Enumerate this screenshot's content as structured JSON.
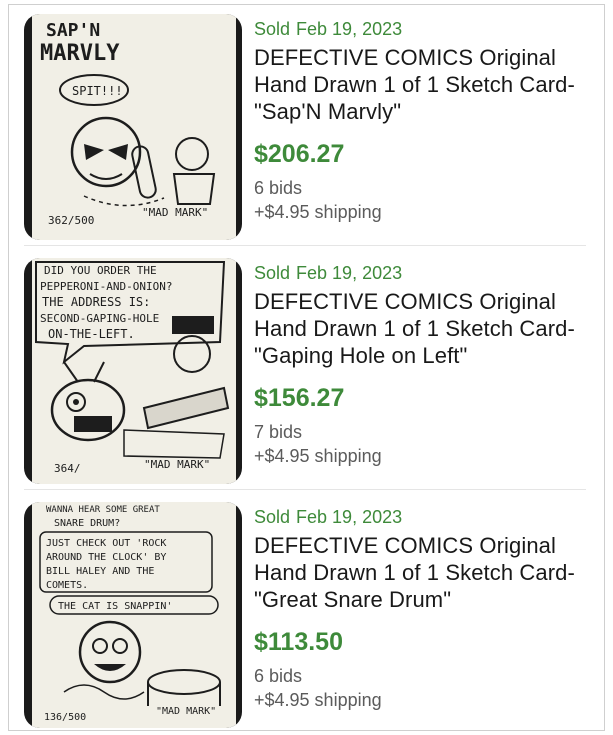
{
  "listings": [
    {
      "status": "Sold",
      "date": "Feb 19, 2023",
      "title_lines": [
        "DEFECTIVE COMICS Original",
        "Hand Drawn 1 of 1 Sketch Card-",
        "\"Sap'N Marvly\""
      ],
      "price": "$206.27",
      "bids": "6 bids",
      "shipping": "+$4.95 shipping",
      "thumb": {
        "headline": [
          "SAP'N",
          "MARVLY"
        ],
        "balloon": "SPIT!!!",
        "number": "362/500",
        "signature": "\"MAD MARK\""
      }
    },
    {
      "status": "Sold",
      "date": "Feb 19, 2023",
      "title_lines": [
        "DEFECTIVE COMICS Original",
        "Hand Drawn 1 of 1 Sketch Card-",
        "\"Gaping Hole on Left\""
      ],
      "price": "$156.27",
      "bids": "7 bids",
      "shipping": "+$4.95 shipping",
      "thumb": {
        "balloon_lines": [
          "DID YOU ORDER THE",
          "PEPPERONI-AND-ONION?",
          "THE ADDRESS IS:",
          "SECOND-GAPING-HOLE",
          "ON-THE-LEFT."
        ],
        "number": "364/",
        "signature": "\"MAD MARK\""
      }
    },
    {
      "status": "Sold",
      "date": "Feb 19, 2023",
      "title_lines": [
        "DEFECTIVE COMICS Original",
        "Hand Drawn 1 of 1 Sketch Card-",
        "\"Great Snare Drum\""
      ],
      "price": "$113.50",
      "bids": "6 bids",
      "shipping": "+$4.95 shipping",
      "thumb": {
        "top_lines": [
          "WANNA HEAR SOME GREAT",
          "SNARE DRUM?"
        ],
        "box_lines": [
          "JUST CHECK OUT 'ROCK",
          "AROUND THE CLOCK' BY",
          "BILL HALEY AND THE",
          "COMETS."
        ],
        "caption": "THE CAT IS SNAPPIN'",
        "number": "136/500",
        "signature": "\"MAD MARK\""
      }
    }
  ]
}
